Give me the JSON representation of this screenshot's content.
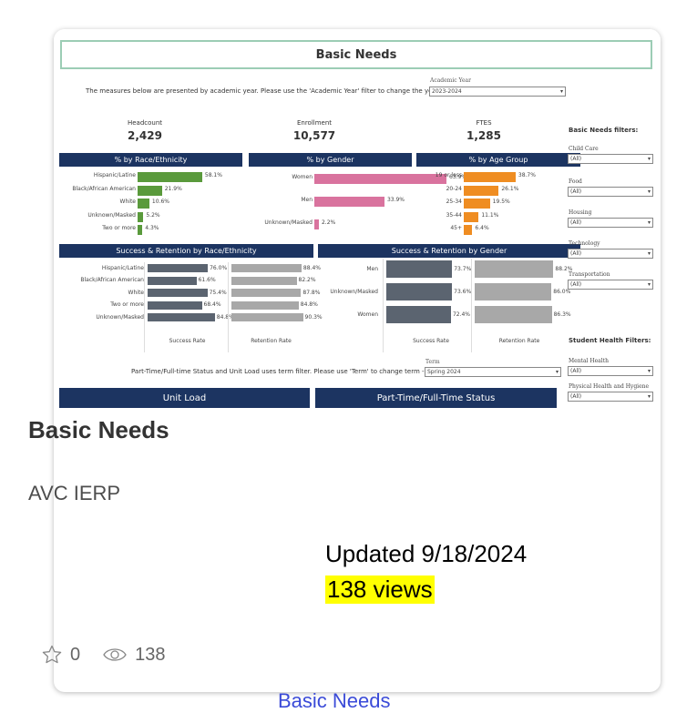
{
  "dashboard": {
    "title": "Basic Needs",
    "instruction": "The measures below are presented by academic year. Please use the 'Academic Year' filter to change the year ->",
    "academic_year_label": "Academic Year",
    "academic_year_value": "2023-2024",
    "kpis": [
      {
        "label": "Headcount",
        "value": "2,429"
      },
      {
        "label": "Enrollment",
        "value": "10,577"
      },
      {
        "label": "FTES",
        "value": "1,285"
      }
    ],
    "filters_heading": "Basic Needs filters:",
    "filters": [
      {
        "label": "Child Care",
        "value": "(All)"
      },
      {
        "label": "Food",
        "value": "(All)"
      },
      {
        "label": "Housing",
        "value": "(All)"
      },
      {
        "label": "Technology",
        "value": "(All)"
      },
      {
        "label": "Transportation",
        "value": "(All)"
      }
    ],
    "health_heading": "Student Health Filters:",
    "health_filters": [
      {
        "label": "Mental Health",
        "value": "(All)"
      },
      {
        "label": "Physical Health and Hygiene",
        "value": "(All)"
      }
    ],
    "term_instruction": "Part-Time/Full-time Status and Unit Load uses term filter. Please use 'Term' to change term ->",
    "term_label": "Term",
    "term_value": "Spring 2024",
    "bottom_panels": [
      "Unit Load",
      "Part-Time/Full-Time Status"
    ],
    "colors": {
      "header_navy": "#1c3461",
      "green": "#5a9a3c",
      "pink": "#d9739e",
      "orange": "#ef8d22",
      "dark_gray": "#5b6470",
      "light_gray": "#a8a8a8",
      "title_border": "#9ccdb5"
    }
  },
  "chart_data": [
    {
      "type": "bar",
      "title": "% by Race/Ethnicity",
      "categories": [
        "Hispanic/Latine",
        "Black/African American",
        "White",
        "Unknown/Masked",
        "Two or more"
      ],
      "values": [
        58.1,
        21.9,
        10.6,
        5.2,
        4.3
      ],
      "labels": [
        "58.1%",
        "21.9%",
        "10.6%",
        "5.2%",
        "4.3%"
      ]
    },
    {
      "type": "bar",
      "title": "% by Gender",
      "categories": [
        "Women",
        "Men",
        "Unknown/Masked"
      ],
      "values": [
        63.9,
        33.9,
        2.2
      ],
      "labels": [
        "63.9%",
        "33.9%",
        "2.2%"
      ]
    },
    {
      "type": "bar",
      "title": "% by Age Group",
      "categories": [
        "19 or less",
        "20-24",
        "25-34",
        "35-44",
        "45+"
      ],
      "values": [
        38.7,
        26.1,
        19.5,
        11.1,
        6.4
      ],
      "labels": [
        "38.7%",
        "26.1%",
        "19.5%",
        "11.1%",
        "6.4%"
      ]
    },
    {
      "type": "bar",
      "title": "Success & Retention by Race/Ethnicity",
      "categories": [
        "Hispanic/Latine",
        "Black/African American",
        "White",
        "Two or more",
        "Unknown/Masked"
      ],
      "series": [
        {
          "name": "Success Rate",
          "values": [
            76.0,
            61.6,
            75.4,
            68.4,
            84.8
          ],
          "labels": [
            "76.0%",
            "61.6%",
            "75.4%",
            "68.4%",
            "84.8%"
          ]
        },
        {
          "name": "Retention Rate",
          "values": [
            88.4,
            82.2,
            87.8,
            84.8,
            90.3
          ],
          "labels": [
            "88.4%",
            "82.2%",
            "87.8%",
            "84.8%",
            "90.3%"
          ]
        }
      ]
    },
    {
      "type": "bar",
      "title": "Success & Retention by Gender",
      "categories": [
        "Men",
        "Unknown/Masked",
        "Women"
      ],
      "series": [
        {
          "name": "Success Rate",
          "values": [
            73.7,
            73.6,
            72.4
          ],
          "labels": [
            "73.7%",
            "73.6%",
            "72.4%"
          ]
        },
        {
          "name": "Retention Rate",
          "values": [
            88.2,
            86.0,
            86.3
          ],
          "labels": [
            "88.2%",
            "86.0%",
            "86.3%"
          ]
        }
      ]
    }
  ],
  "card": {
    "title": "Basic Needs",
    "author": "AVC IERP",
    "updated": "Updated 9/18/2024",
    "views_highlight": "138 views",
    "favorites": "0",
    "views": "138",
    "link_text": "Basic Needs"
  }
}
